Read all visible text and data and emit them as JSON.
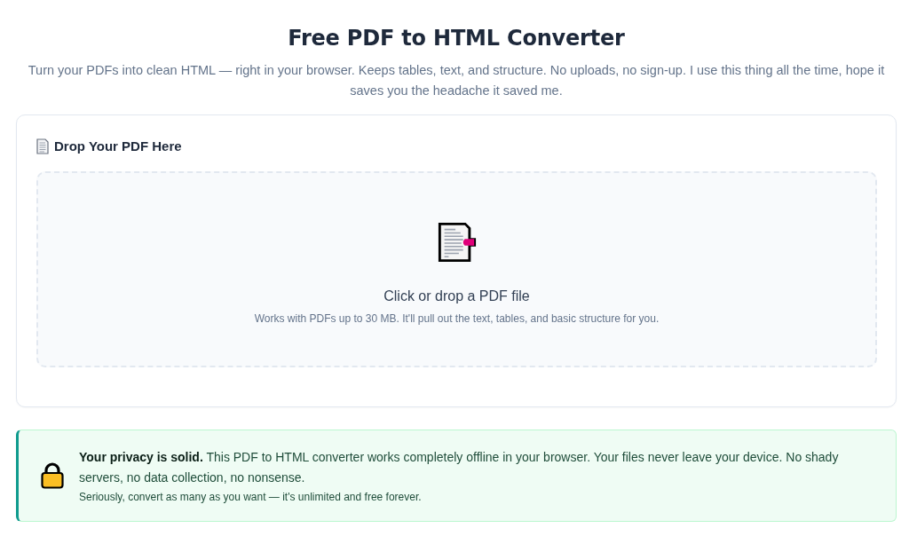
{
  "header": {
    "title": "Free PDF to HTML Converter",
    "subtitle": "Turn your PDFs into clean HTML — right in your browser. Keeps tables, text, and structure. No uploads, no sign-up. I use this thing all the time, hope it saves you the headache it saved me."
  },
  "upload_card": {
    "heading": "Drop Your PDF Here",
    "dropzone": {
      "prompt": "Click or drop a PDF file",
      "hint": "Works with PDFs up to 30 MB. It'll pull out the text, tables, and basic structure for you."
    }
  },
  "privacy_notice": {
    "text": "**Your privacy is solid.** This PDF to HTML converter works completely offline in your browser. Your files never leave your device. No shady servers, no data collection, no nonsense.",
    "note": "Seriously, convert as many as you want — it's unlimited and free forever."
  }
}
